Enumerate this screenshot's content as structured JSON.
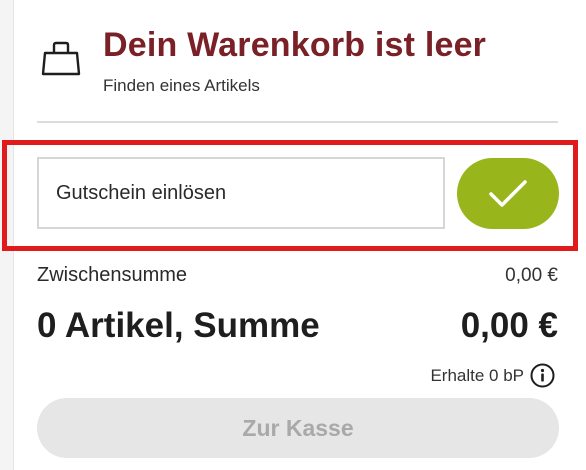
{
  "cart": {
    "title": "Dein Warenkorb ist leer",
    "subtitle": "Finden eines Artikels",
    "bag_icon": "shopping-bag-icon"
  },
  "voucher": {
    "placeholder": "Gutschein einlösen",
    "submit_icon": "checkmark-icon",
    "submit_color": "#98b61b"
  },
  "summary": {
    "subtotal_label": "Zwischensumme",
    "subtotal_value": "0,00 €",
    "total_label": "0 Artikel, Summe",
    "total_value": "0,00 €",
    "bonus_text": "Erhalte 0 bP",
    "info_icon": "info-icon"
  },
  "checkout": {
    "label": "Zur Kasse",
    "disabled": true
  },
  "colors": {
    "title": "#7a2027",
    "highlight": "#e01b1b",
    "button_disabled_bg": "#e6e6e6",
    "button_disabled_text": "#a9a9a9"
  }
}
